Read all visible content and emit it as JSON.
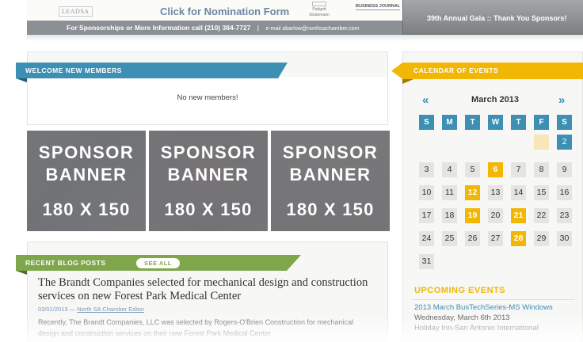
{
  "top_banner": {
    "logo_left": "LEADSA",
    "nomination_link": "Click for Nomination Form",
    "logo_padgett": "Padgett Stratemann",
    "logo_business_journal": "BUSINESS JOURNAL",
    "info_bar": {
      "sponsorship_text": "For Sponsorships or More Information call",
      "phone": "(210) 384-7727",
      "separator": "|",
      "email_text": "e-mail abarlow@northsachamber.com"
    },
    "gala_text": "39th Annual Gala :: Thank You Sponsors!"
  },
  "welcome": {
    "title": "WELCOME NEW MEMBERS",
    "empty_message": "No new members!"
  },
  "sponsors": [
    {
      "label_line1": "SPONSOR",
      "label_line2": "BANNER",
      "dims": "180 X 150"
    },
    {
      "label_line1": "SPONSOR",
      "label_line2": "BANNER",
      "dims": "180 X 150"
    },
    {
      "label_line1": "SPONSOR",
      "label_line2": "BANNER",
      "dims": "180 X 150"
    }
  ],
  "blog": {
    "title": "RECENT BLOG POSTS",
    "see_all": "SEE ALL",
    "post": {
      "title": "The Brandt Companies selected for mechanical design and construction services on new Forest Park Medical Center",
      "date": "03/01/2013",
      "dash": "—",
      "author": "North SA Chamber Editor",
      "excerpt": "Recently, The Brandt Companies, LLC was selected by Rogers-O'Brien Construction for mechanical design and construction services on their new Forest Park Medical Center"
    }
  },
  "calendar": {
    "title": "CALENDAR OF EVENTS",
    "prev": "«",
    "next": "»",
    "month": "March 2013",
    "weekdays": [
      "S",
      "M",
      "T",
      "W",
      "T",
      "F",
      "S"
    ],
    "colors": {
      "accent_blue": "#3d8fb3",
      "accent_gold": "#f2b705",
      "accent_green": "#7fa64a"
    },
    "weeks": [
      [
        {
          "d": ""
        },
        {
          "d": ""
        },
        {
          "d": ""
        },
        {
          "d": ""
        },
        {
          "d": ""
        },
        {
          "d": "1",
          "s": "faded"
        },
        {
          "d": "2",
          "s": "today"
        }
      ],
      [
        {
          "d": "3"
        },
        {
          "d": "4"
        },
        {
          "d": "5"
        },
        {
          "d": "6",
          "s": "event"
        },
        {
          "d": "7"
        },
        {
          "d": "8"
        },
        {
          "d": "9"
        }
      ],
      [
        {
          "d": "10"
        },
        {
          "d": "11"
        },
        {
          "d": "12",
          "s": "event"
        },
        {
          "d": "13"
        },
        {
          "d": "14"
        },
        {
          "d": "15"
        },
        {
          "d": "16"
        }
      ],
      [
        {
          "d": "17"
        },
        {
          "d": "18"
        },
        {
          "d": "19",
          "s": "event"
        },
        {
          "d": "20"
        },
        {
          "d": "21",
          "s": "event"
        },
        {
          "d": "22"
        },
        {
          "d": "23"
        }
      ],
      [
        {
          "d": "24"
        },
        {
          "d": "25"
        },
        {
          "d": "26"
        },
        {
          "d": "27"
        },
        {
          "d": "28",
          "s": "event"
        },
        {
          "d": "29"
        },
        {
          "d": "30"
        }
      ],
      [
        {
          "d": "31"
        }
      ]
    ]
  },
  "upcoming": {
    "title": "UPCOMING EVENTS",
    "event_title": "2013 March BusTechSeries-MS Windows",
    "event_date": "Wednesday, March 6th 2013",
    "event_location": "Holiday Inn-San Antonio International"
  }
}
